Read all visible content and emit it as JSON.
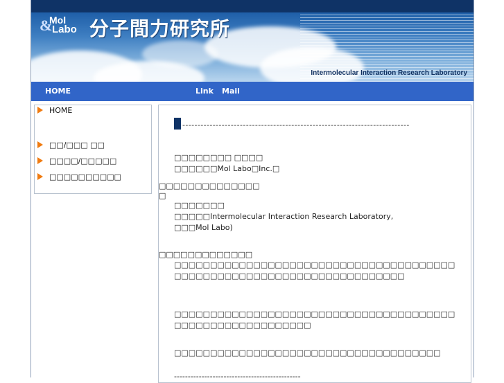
{
  "header": {
    "logo_line1": "Mol",
    "logo_line2": "Labo",
    "logo_amp": "&",
    "title": "分子間力研究所",
    "subtitle": "Intermolecular Interaction Research Laboratory"
  },
  "nav": {
    "home": "HOME",
    "link": "Link",
    "mail": "Mail"
  },
  "sidebar": {
    "items": [
      {
        "label": "HOME"
      },
      {
        "label": "□□/□□□ □□"
      },
      {
        "label": "□□□□/□□□□□"
      },
      {
        "label": "□□□□□□□□□□"
      }
    ]
  },
  "content": {
    "heading_rule": "---------------------------------------------------------------------------",
    "company_line1": "□□□□□□□□ □□□□",
    "company_line2": "□□□□□□Mol Labo□Inc.□",
    "section1_title": "□□□□□□□□□□□□□□",
    "section1_mark": "□",
    "lab_line1": "□□□□□□□",
    "lab_line2": "□□□□□Intermolecular Interaction Research Laboratory,",
    "lab_line3": "□□□Mol Labo)",
    "section2_title": "□□□□□□□□□□□□□",
    "para1": "□□□□□□□□□□□□□□□□□□□□□□□□□□□□□□□□□□□□□□□□□□□□□□□□□□□□□□□□□□□□□□□□□□□□□□□",
    "para2": "□□□□□□□□□□□□□□□□□□□□□□□□□□□□□□□□□□□□□□□□□□□□□□□□□□□□□□□□□□",
    "para3": "□□□□□□□□□□□□□□□□□□□□□□□□□□□□□□□□□□□□□",
    "bottom_rule": "----------------------------------------------"
  },
  "colors": {
    "topbar": "#0f3366",
    "navbar": "#3165c8",
    "arrow": "#f07b10"
  }
}
